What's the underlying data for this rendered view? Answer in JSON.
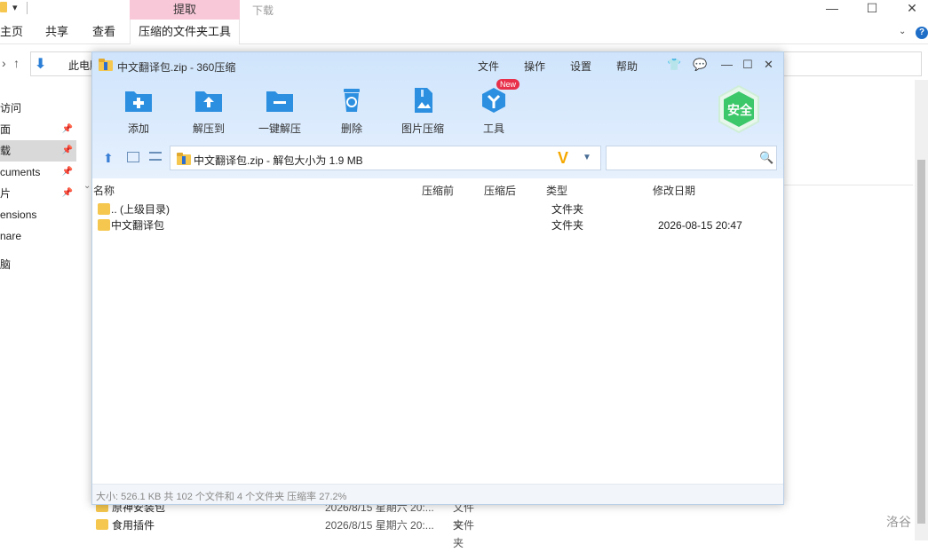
{
  "explorer": {
    "ribbon_context_group": "提取",
    "ribbon_download": "下载",
    "tabs": [
      "主页",
      "共享",
      "查看",
      "压缩的文件夹工具"
    ],
    "address": "此电脑",
    "nav_items": [
      {
        "label": "访问",
        "pinned": false
      },
      {
        "label": "面",
        "pinned": true
      },
      {
        "label": "载",
        "pinned": true
      },
      {
        "label": "cuments",
        "pinned": true
      },
      {
        "label": "片",
        "pinned": true
      },
      {
        "label": "ensions",
        "pinned": false
      },
      {
        "label": "nare",
        "pinned": false
      },
      {
        "label": "脑",
        "pinned": false
      }
    ],
    "rows": [
      {
        "name": "原神安装包",
        "date": "2026/8/15 星期六 20:...",
        "type": "文件夹"
      },
      {
        "name": "食用插件",
        "date": "2026/8/15 星期六 20:...",
        "type": "文件夹"
      }
    ],
    "watermark": "洛谷"
  },
  "zip": {
    "title": "中文翻译包.zip - 360压缩",
    "menu": [
      "文件",
      "操作",
      "设置",
      "帮助"
    ],
    "toolbar": [
      {
        "label": "添加",
        "icon": "add-folder-icon"
      },
      {
        "label": "解压到",
        "icon": "extract-to-icon"
      },
      {
        "label": "一键解压",
        "icon": "one-click-extract-icon"
      },
      {
        "label": "删除",
        "icon": "trash-icon"
      },
      {
        "label": "图片压缩",
        "icon": "image-compress-icon"
      },
      {
        "label": "工具",
        "icon": "tools-icon"
      }
    ],
    "new_badge": "New",
    "safe_label": "安全",
    "path": "中文翻译包.zip - 解包大小为 1.9 MB",
    "search_placeholder": "",
    "columns": {
      "name": "名称",
      "before": "压缩前",
      "after": "压缩后",
      "type": "类型",
      "modified": "修改日期"
    },
    "files": [
      {
        "name": ".. (上级目录)",
        "type": "文件夹",
        "modified": ""
      },
      {
        "name": "中文翻译包",
        "type": "文件夹",
        "modified": "2026-08-15 20:47"
      }
    ],
    "status": "大小: 526.1 KB 共 102 个文件和 4 个文件夹 压缩率 27.2%"
  },
  "colors": {
    "accent": "#2c8fe0",
    "safe_green": "#3cc76a",
    "new_badge": "#e8304a",
    "context_tab": "#f8c8d8"
  }
}
